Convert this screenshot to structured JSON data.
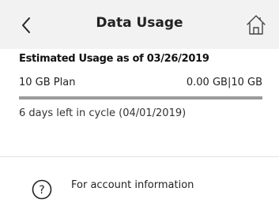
{
  "header": {
    "title": "Data Usage",
    "back_icon": "chevron-left-icon",
    "home_icon": "home-icon",
    "background": "#f2f2f2"
  },
  "usage": {
    "estimated_label": "Estimated Usage as of 03/26/2019",
    "plan_name": "10 GB Plan",
    "used_summary": "0.00 GB|10 GB",
    "progress_fraction": 0.0,
    "bar_track_color": "#9b9b9b",
    "bar_fill_color": "#5a6f8a",
    "cycle_text": "6 days left in cycle (04/01/2019)"
  },
  "footer": {
    "help_icon": "question-circle-icon",
    "account_info_text": "For account information"
  }
}
